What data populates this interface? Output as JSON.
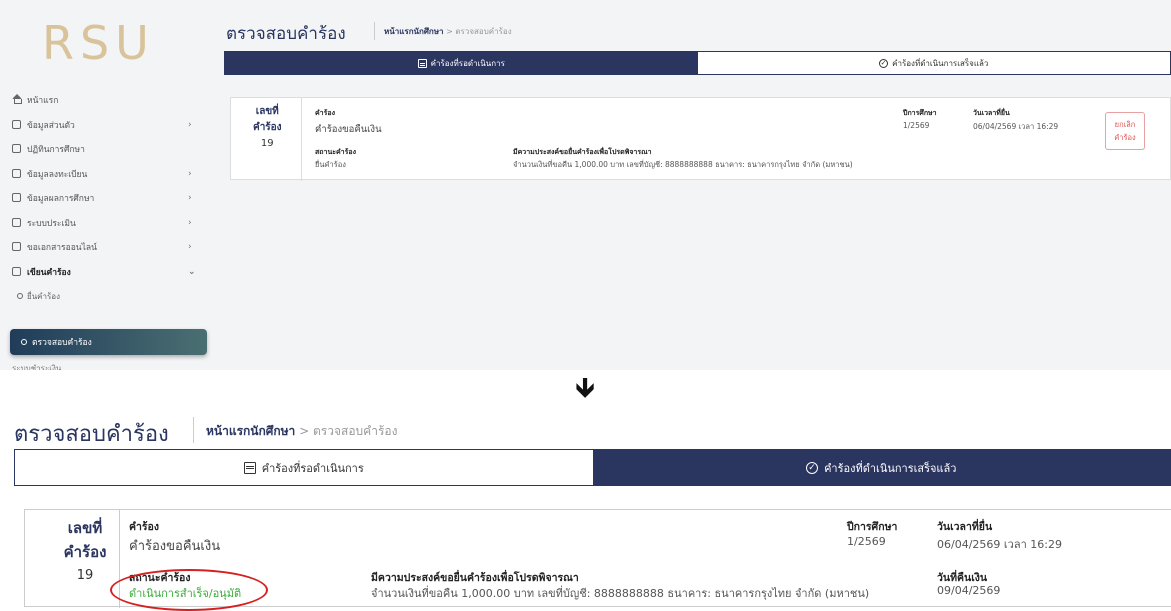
{
  "top": {
    "logo": "RSU",
    "menu": [
      {
        "label": "หน้าแรก",
        "icon": "home-icon",
        "chev": ""
      },
      {
        "label": "ข้อมูลส่วนตัว",
        "icon": "profile-icon",
        "chev": "›"
      },
      {
        "label": "ปฏิทินการศึกษา",
        "icon": "calendar-icon",
        "chev": ""
      },
      {
        "label": "ข้อมูลลงทะเบียน",
        "icon": "register-icon",
        "chev": "›"
      },
      {
        "label": "ข้อมูลผลการศึกษา",
        "icon": "grades-icon",
        "chev": "›"
      },
      {
        "label": "ระบบประเมิน",
        "icon": "evaluation-icon",
        "chev": "›"
      },
      {
        "label": "ขอเอกสารออนไลน์",
        "icon": "document-icon",
        "chev": "›"
      },
      {
        "label": "เขียนคำร้อง",
        "icon": "write-icon",
        "chev": "⌄"
      }
    ],
    "sub_submit": "ยื่นคำร้อง",
    "sub_active": "ตรวจสอบคำร้อง",
    "cut_item": "ระบบชำระเงิน",
    "title": "ตรวจสอบคำร้อง",
    "crumb_home": "หน้าแรกนักศึกษา",
    "crumb_sep": ">",
    "crumb_current": "ตรวจสอบคำร้อง",
    "tab_pending": "คำร้องที่รอดำเนินการ",
    "tab_done": "คำร้องที่ดำเนินการเสร็จแล้ว",
    "card": {
      "no_label_1": "เลขที่",
      "no_label_2": "คำร้อง",
      "no": "19",
      "req_label": "คำร้อง",
      "req": "คำร้องขอคืนเงิน",
      "status_label": "สถานะคำร้อง",
      "status": "ยื่นคำร้อง",
      "purpose_label": "มีความประสงค์ขอยื่นคำร้องเพื่อโปรดพิจารณา",
      "purpose": "จำนวนเงินที่ขอคืน 1,000.00 บาท เลขที่บัญชี: 8888888888 ธนาคาร: ธนาคารกรุงไทย จำกัด (มหาชน)",
      "year_label": "ปีการศึกษา",
      "year": "1/2569",
      "date_label": "วันเวลาที่ยื่น",
      "date": "06/04/2569 เวลา 16:29",
      "cancel_1": "ยกเลิก",
      "cancel_2": "คำร้อง"
    }
  },
  "arrow": "🡻",
  "bottom": {
    "title": "ตรวจสอบคำร้อง",
    "crumb_home": "หน้าแรกนักศึกษา",
    "crumb_sep": ">",
    "crumb_current": "ตรวจสอบคำร้อง",
    "tab_pending": "คำร้องที่รอดำเนินการ",
    "tab_done": "คำร้องที่ดำเนินการเสร็จแล้ว",
    "card": {
      "no_label_1": "เลขที่",
      "no_label_2": "คำร้อง",
      "no": "19",
      "req_label": "คำร้อง",
      "req": "คำร้องขอคืนเงิน",
      "status_label": "สถานะคำร้อง",
      "status": "ดำเนินการสำเร็จ/อนุมัติ",
      "purpose_label": "มีความประสงค์ขอยื่นคำร้องเพื่อโปรดพิจารณา",
      "purpose": "จำนวนเงินที่ขอคืน 1,000.00 บาท เลขที่บัญชี: 8888888888 ธนาคาร: ธนาคารกรุงไทย จำกัด (มหาชน)",
      "year_label": "ปีการศึกษา",
      "year": "1/2569",
      "date_label": "วันเวลาที่ยื่น",
      "date": "06/04/2569 เวลา 16:29",
      "refund_label": "วันที่คืนเงิน",
      "refund": "09/04/2569"
    }
  },
  "colors": {
    "navy": "#2a3560",
    "status_green": "#3bab3b",
    "highlight_red": "#d62020",
    "logo_gold": "#d8c39a"
  }
}
